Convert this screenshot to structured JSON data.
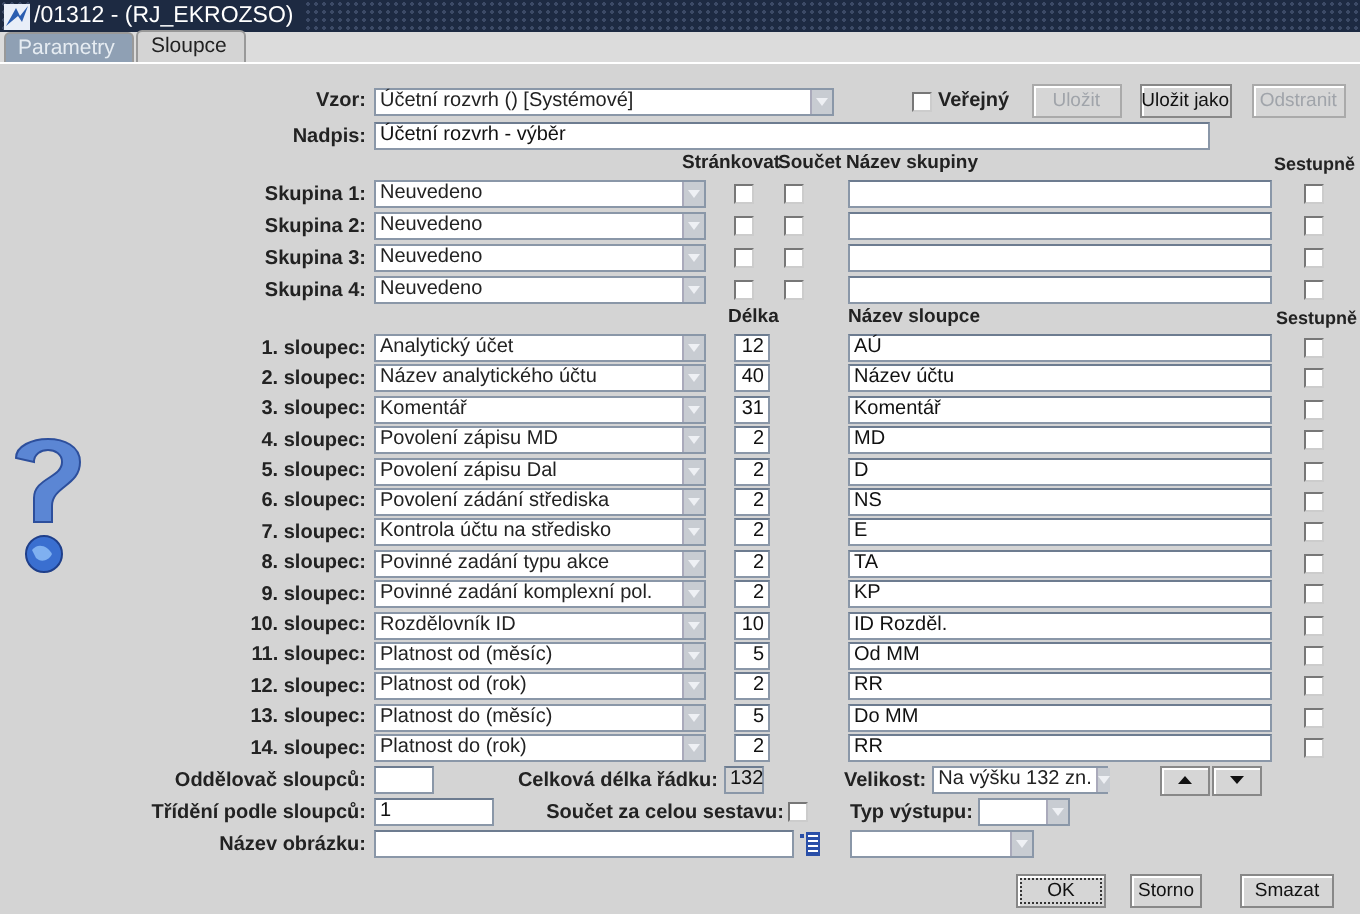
{
  "window": {
    "title": "/01312 - (RJ_EKROZSO)"
  },
  "tabs": [
    {
      "label": "Parametry",
      "selected": false
    },
    {
      "label": "Sloupce",
      "selected": true
    }
  ],
  "template": {
    "label": "Vzor:",
    "value": "Účetní rozvrh   ()   [Systémové]"
  },
  "public": {
    "label": "Veřejný",
    "checked": false
  },
  "top_buttons": [
    {
      "label": "Uložit",
      "disabled": true
    },
    {
      "label": "Uložit jako",
      "disabled": false
    },
    {
      "label": "Odstranit",
      "disabled": true
    }
  ],
  "heading": {
    "label": "Nadpis:",
    "value": "Účetní rozvrh - výběr"
  },
  "groups": {
    "headers": {
      "paging": "Stránkovat",
      "sum": "Součet",
      "name": "Název skupiny",
      "descending": "Sestupně"
    },
    "rows": [
      {
        "label": "Skupina 1:",
        "value": "Neuvedeno",
        "paging": false,
        "sum": false,
        "descending": false
      },
      {
        "label": "Skupina 2:",
        "value": "Neuvedeno",
        "paging": false,
        "sum": false,
        "descending": false
      },
      {
        "label": "Skupina 3:",
        "value": "Neuvedeno",
        "paging": false,
        "sum": false,
        "descending": false
      },
      {
        "label": "Skupina 4:",
        "value": "Neuvedeno",
        "paging": false,
        "sum": false,
        "descending": false
      }
    ]
  },
  "columns": {
    "headers": {
      "length": "Délka",
      "name": "Název sloupce",
      "descending": "Sestupně"
    },
    "rows": [
      {
        "label": "1. sloupec:",
        "value": "Analytický účet",
        "length": "12",
        "name": "AÚ",
        "descending": false
      },
      {
        "label": "2. sloupec:",
        "value": "Název analytického účtu",
        "length": "40",
        "name": "Název účtu",
        "descending": false
      },
      {
        "label": "3. sloupec:",
        "value": "Komentář",
        "length": "31",
        "name": "Komentář",
        "descending": false
      },
      {
        "label": "4. sloupec:",
        "value": "Povolení zápisu MD",
        "length": "2",
        "name": "MD",
        "descending": false
      },
      {
        "label": "5. sloupec:",
        "value": "Povolení zápisu Dal",
        "length": "2",
        "name": "D",
        "descending": false
      },
      {
        "label": "6. sloupec:",
        "value": "Povolení zádání střediska",
        "length": "2",
        "name": "NS",
        "descending": false
      },
      {
        "label": "7. sloupec:",
        "value": "Kontrola účtu na středisko",
        "length": "2",
        "name": "E",
        "descending": false
      },
      {
        "label": "8. sloupec:",
        "value": "Povinné zadání typu akce",
        "length": "2",
        "name": "TA",
        "descending": false
      },
      {
        "label": "9. sloupec:",
        "value": "Povinné zadání komplexní pol.",
        "length": "2",
        "name": "KP",
        "descending": false
      },
      {
        "label": "10. sloupec:",
        "value": "Rozdělovník ID",
        "length": "10",
        "name": "ID Rozděl.",
        "descending": false
      },
      {
        "label": "11. sloupec:",
        "value": "Platnost od (měsíc)",
        "length": "5",
        "name": "Od MM",
        "descending": false
      },
      {
        "label": "12. sloupec:",
        "value": "Platnost od (rok)",
        "length": "2",
        "name": "RR",
        "descending": false
      },
      {
        "label": "13. sloupec:",
        "value": "Platnost do (měsíc)",
        "length": "5",
        "name": "Do MM",
        "descending": false
      },
      {
        "label": "14. sloupec:",
        "value": "Platnost do (rok)",
        "length": "2",
        "name": "RR",
        "descending": false
      }
    ]
  },
  "separator": {
    "label": "Oddělovač sloupců:"
  },
  "total_length": {
    "label": "Celková délka řádku:",
    "value": "132"
  },
  "size": {
    "label": "Velikost:",
    "value": "Na výšku 132 zn."
  },
  "sorting": {
    "label": "Třídění podle sloupců:",
    "value": "1"
  },
  "grand_total": {
    "label": "Součet za celou sestavu:",
    "checked": false
  },
  "output_type": {
    "label": "Typ výstupu:"
  },
  "image_name": {
    "label": "Název obrázku:"
  },
  "dialog_buttons": [
    {
      "label": "OK",
      "focused": true
    },
    {
      "label": "Storno",
      "focused": false
    },
    {
      "label": "Smazat",
      "focused": false
    }
  ]
}
